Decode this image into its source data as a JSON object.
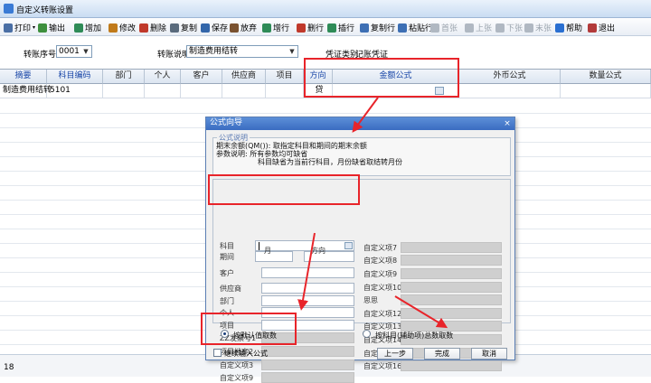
{
  "window": {
    "title": "自定义转账设置"
  },
  "toolbar": {
    "items": [
      {
        "label": "打印",
        "icon": "printer-icon",
        "has_arrow": true,
        "disabled": false
      },
      {
        "label": "输出",
        "icon": "export-icon",
        "disabled": false
      },
      {
        "label": "增加",
        "icon": "add-icon",
        "disabled": false
      },
      {
        "label": "修改",
        "icon": "edit-icon",
        "disabled": false
      },
      {
        "label": "删除",
        "icon": "delete-icon",
        "disabled": false
      },
      {
        "label": "复制",
        "icon": "copy-icon",
        "disabled": false
      },
      {
        "label": "保存",
        "icon": "save-icon",
        "disabled": false
      },
      {
        "label": "放弃",
        "icon": "undo-icon",
        "disabled": false
      },
      {
        "label": "增行",
        "icon": "add-row-icon",
        "disabled": false
      },
      {
        "label": "删行",
        "icon": "delete-row-icon",
        "disabled": false
      },
      {
        "label": "插行",
        "icon": "insert-row-icon",
        "disabled": false
      },
      {
        "label": "复制行",
        "icon": "copy-row-icon",
        "disabled": false
      },
      {
        "label": "粘贴行",
        "icon": "paste-row-icon",
        "disabled": false
      },
      {
        "label": "首张",
        "icon": "first-icon",
        "disabled": true
      },
      {
        "label": "上张",
        "icon": "prev-icon",
        "disabled": true
      },
      {
        "label": "下张",
        "icon": "next-icon",
        "disabled": true
      },
      {
        "label": "末张",
        "icon": "last-icon",
        "disabled": true
      },
      {
        "label": "帮助",
        "icon": "help-icon",
        "disabled": false
      },
      {
        "label": "退出",
        "icon": "exit-icon",
        "disabled": false
      }
    ]
  },
  "filters": {
    "serial_label": "转账序号",
    "serial_value": "0001",
    "desc_label": "转账说明",
    "desc_value": "制造费用结转",
    "voucher_type_label": "凭证类别",
    "voucher_type_value": "记账凭证"
  },
  "grid": {
    "headers": [
      "摘要",
      "科目编码",
      "部门",
      "个人",
      "客户",
      "供应商",
      "项目",
      "方向",
      "金额公式",
      "外币公式",
      "数量公式"
    ],
    "rows": [
      [
        "制造费用结转",
        "5101",
        "",
        "",
        "",
        "",
        "",
        "贷",
        "",
        "",
        ""
      ]
    ]
  },
  "statusbar": {
    "value": "18"
  },
  "dialog": {
    "title": "公式向导",
    "desc_legend": "公式说明",
    "desc_lines": [
      "期末余额(QM()): 取指定科目和期间的期末余额",
      "参数说明: 所有参数均可缺省",
      "科目缺省为当前行科目，月份缺省取结转月份"
    ],
    "left_fields": [
      {
        "label": "科目",
        "value": "",
        "disabled": false
      },
      {
        "label": "期间",
        "value": "月",
        "disabled": false
      },
      {
        "label": "客户",
        "value": "",
        "disabled": false
      },
      {
        "label": "供应商",
        "value": "",
        "disabled": false
      },
      {
        "label": "部门",
        "value": "",
        "disabled": false
      },
      {
        "label": "个人",
        "value": "",
        "disabled": false
      },
      {
        "label": "项目",
        "value": "",
        "disabled": false
      },
      {
        "label": "ZZ发票号1",
        "value": "",
        "disabled": true
      },
      {
        "label": "项目档案2",
        "value": "",
        "disabled": true
      },
      {
        "label": "自定义项3",
        "value": "",
        "disabled": true
      },
      {
        "label": "自定义项9",
        "value": "",
        "disabled": true
      }
    ],
    "direction_label": "方向",
    "direction_value": "",
    "right_fields": [
      {
        "label": "自定义项7"
      },
      {
        "label": "自定义项8"
      },
      {
        "label": "自定义项9"
      },
      {
        "label": "自定义项10"
      },
      {
        "label": "思思"
      },
      {
        "label": "自定义项12"
      },
      {
        "label": "自定义项13"
      },
      {
        "label": "自定义项14"
      },
      {
        "label": "自定义项15"
      },
      {
        "label": "自定义项16"
      }
    ],
    "radio_default": "按默认值取数",
    "radio_aux": "按科目(辅助项)总数取数",
    "continue_label": "继续输入公式",
    "btn_prev": "上一步",
    "btn_finish": "完成",
    "btn_cancel": "取消"
  },
  "colors": {
    "highlight": "#e8242a",
    "title_blue": "#3a6cc1"
  }
}
